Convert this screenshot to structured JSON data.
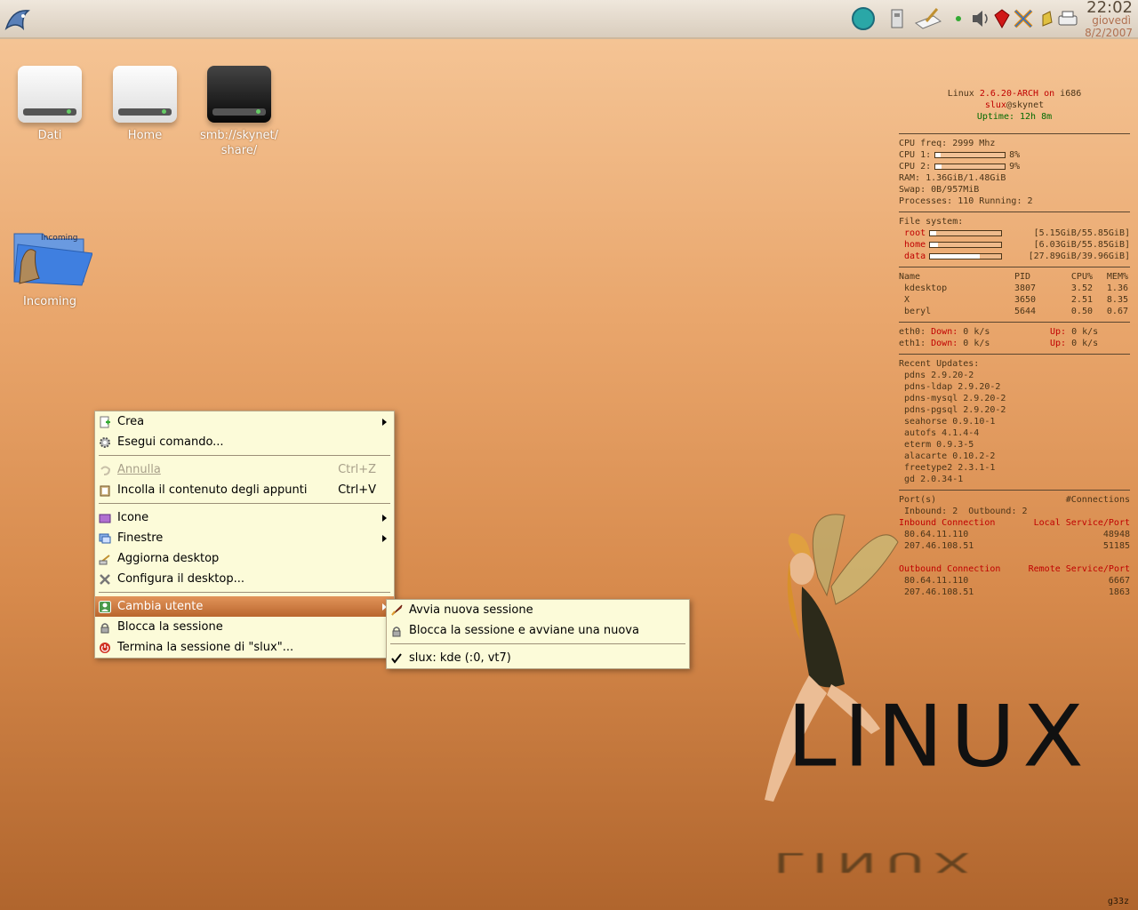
{
  "panel": {
    "clock_time": "22:02",
    "clock_day": "giovedì",
    "clock_date": "8/2/2007",
    "tray_icons": [
      "kde-menu-icon",
      "globe-icon",
      "usb-stick-icon",
      "notes-icon",
      "green-dot-icon",
      "volume-icon",
      "ruby-icon",
      "network-icon",
      "pen-icon",
      "printer-icon"
    ]
  },
  "desktop": {
    "icons": [
      {
        "label": "Dati"
      },
      {
        "label": "Home"
      },
      {
        "label": "smb://skynet/\nshare/"
      },
      {
        "label": "Incoming",
        "folder_tag": "Incoming"
      }
    ]
  },
  "conky": {
    "line1_a": "Linux ",
    "line1_kernel": "2.6.20-ARCH",
    "line1_on": " on ",
    "line1_arch": "i686",
    "user": "slux",
    "host": "@skynet",
    "uptime": "Uptime: 12h 8m",
    "cpu_freq": "CPU freq: 2999 Mhz",
    "cpu1_label": "CPU 1:",
    "cpu1_val": "8%",
    "cpu1_pct": 8,
    "cpu2_label": "CPU 2:",
    "cpu2_val": "9%",
    "cpu2_pct": 9,
    "ram": "RAM: 1.36GiB/1.48GiB",
    "swap": "Swap: 0B/957MiB",
    "processes": "Processes: 110 Running: 2",
    "fs_title": "File system:",
    "fs": [
      {
        "name": "root",
        "val": "[5.15GiB/55.85GiB]",
        "pct": 9
      },
      {
        "name": "home",
        "val": "[6.03GiB/55.85GiB]",
        "pct": 11
      },
      {
        "name": "data",
        "val": "[27.89GiB/39.96GiB]",
        "pct": 70
      }
    ],
    "proc_headers": [
      "Name",
      "PID",
      "CPU%",
      "MEM%"
    ],
    "procs": [
      [
        "kdesktop",
        "3807",
        "3.52",
        "1.36"
      ],
      [
        "X",
        "3650",
        "2.51",
        "8.35"
      ],
      [
        "beryl",
        "5644",
        "0.50",
        "0.67"
      ]
    ],
    "net": [
      {
        "if": "eth0:",
        "down_label": "Down:",
        "down": "0 k/s",
        "up_label": "Up:",
        "up": "0 k/s"
      },
      {
        "if": "eth1:",
        "down_label": "Down:",
        "down": "0 k/s",
        "up_label": "Up:",
        "up": "0 k/s"
      }
    ],
    "updates_title": "Recent Updates:",
    "updates": [
      "pdns 2.9.20-2",
      "pdns-ldap 2.9.20-2",
      "pdns-mysql 2.9.20-2",
      "pdns-pgsql 2.9.20-2",
      "seahorse 0.9.10-1",
      "autofs 4.1.4-4",
      "eterm 0.9.3-5",
      "alacarte 0.10.2-2",
      "freetype2 2.3.1-1",
      "gd 2.0.34-1"
    ],
    "ports_label": "Port(s)",
    "connections_label": "#Connections",
    "inout": "Inbound: 2  Outbound: 2",
    "inbound_title": "Inbound Connection",
    "local_port_title": "Local Service/Port",
    "inbound": [
      [
        "80.64.11.110",
        "48948"
      ],
      [
        "207.46.108.51",
        "51185"
      ]
    ],
    "outbound_title": "Outbound Connection",
    "remote_port_title": "Remote Service/Port",
    "outbound": [
      [
        "80.64.11.110",
        "6667"
      ],
      [
        "207.46.108.51",
        "1863"
      ]
    ]
  },
  "context_menu": {
    "items": [
      {
        "label": "Crea"
      },
      {
        "label": "Esegui comando..."
      },
      {
        "label": "Annulla",
        "shortcut": "Ctrl+Z"
      },
      {
        "label": "Incolla il contenuto degli appunti",
        "shortcut": "Ctrl+V"
      },
      {
        "label": "Icone"
      },
      {
        "label": "Finestre"
      },
      {
        "label": "Aggiorna desktop"
      },
      {
        "label": "Configura il desktop..."
      },
      {
        "label": "Cambia utente"
      },
      {
        "label": "Blocca la sessione"
      },
      {
        "label": "Termina la sessione di \"slux\"..."
      }
    ]
  },
  "submenu": {
    "items": [
      {
        "label": "Avvia nuova sessione"
      },
      {
        "label": "Blocca la sessione e avviane una nuova"
      },
      {
        "label": "slux: kde (:0, vt7)"
      }
    ]
  },
  "wallpaper": {
    "text": "LINUX",
    "reflection": "LINUX",
    "signature": "g33z"
  }
}
